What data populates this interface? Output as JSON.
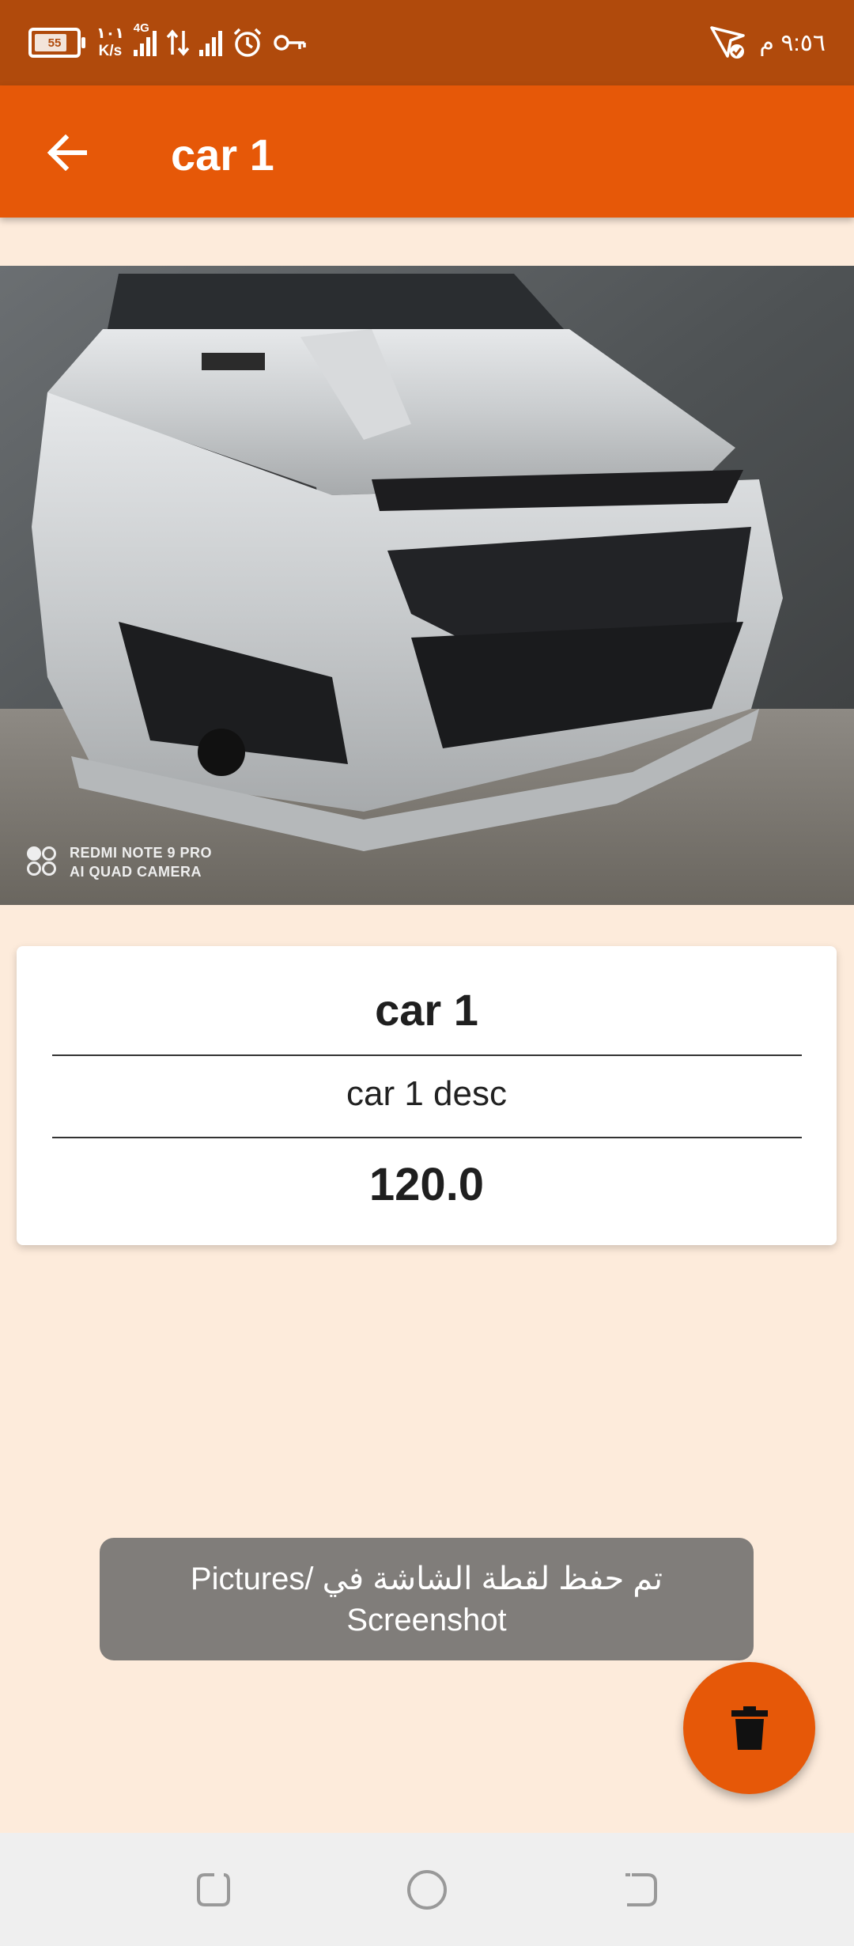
{
  "status_bar": {
    "battery": "55",
    "speed_value": "١٠١",
    "speed_unit": "K/s",
    "network_type": "4G",
    "time": "٩:٥٦ م",
    "icons": [
      "battery-icon",
      "signal-icon",
      "data-arrows-icon",
      "signal-icon",
      "alarm-icon",
      "vpn-key-icon",
      "send-icon"
    ]
  },
  "app_bar": {
    "title": "car 1",
    "back_icon": "arrow-back-icon"
  },
  "image": {
    "watermark_line1": "REDMI NOTE 9 PRO",
    "watermark_line2": "AI QUAD CAMERA"
  },
  "card": {
    "title": "car 1",
    "description": "car 1 desc",
    "price": "120.0"
  },
  "toast": {
    "message": "تم حفظ لقطة الشاشة في /Pictures Screenshot"
  },
  "fab": {
    "icon": "delete-icon"
  },
  "nav_bar": {
    "icons": [
      "recents-icon",
      "home-icon",
      "back-icon"
    ]
  },
  "colors": {
    "status_bar": "#b04a0c",
    "app_bar": "#e65808",
    "background": "#fdebdb",
    "fab": "#e65808",
    "toast": "#807d7a"
  }
}
